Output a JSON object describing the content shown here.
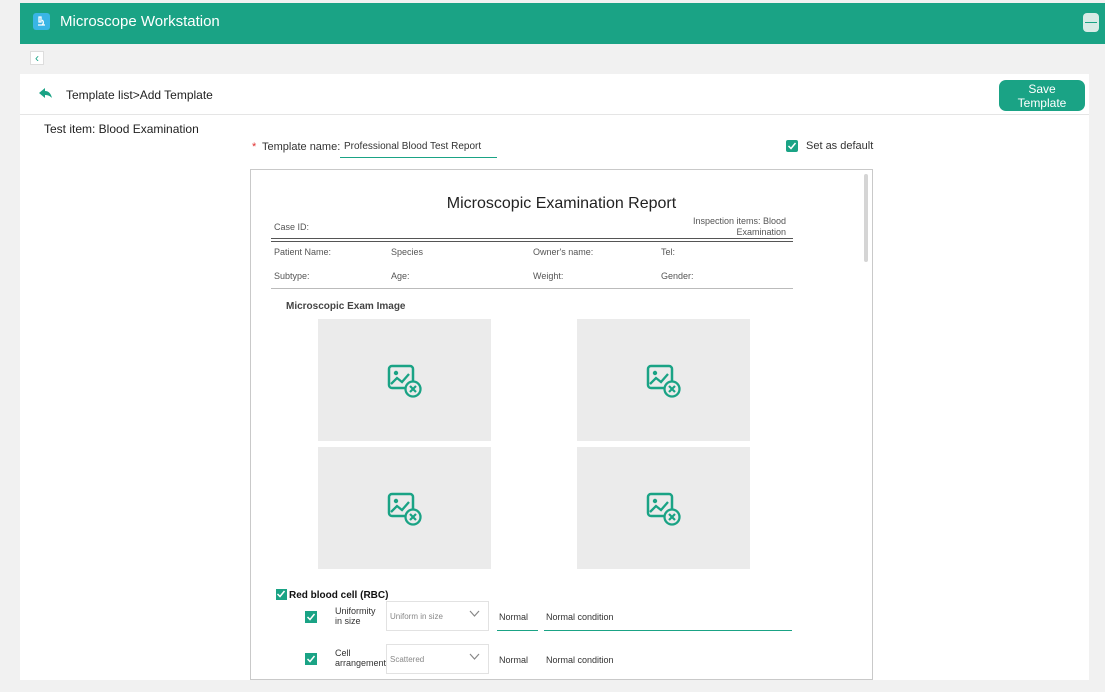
{
  "app": {
    "title": "Microscope Workstation"
  },
  "header": {
    "breadcrumb": "Template list>Add Template",
    "save_label": "Save Template"
  },
  "test_item": "Test item:  Blood Examination",
  "form": {
    "required_mark": "*",
    "template_name_label": "Template name:",
    "template_name_value": "Professional Blood Test Report",
    "set_default_label": "Set as default",
    "set_default_checked": true
  },
  "report": {
    "title": "Microscopic Examination Report",
    "case_id": "Case ID:",
    "inspection_items": "Inspection items: Blood Examination",
    "fields_row1": [
      "Patient Name:",
      "Species",
      "Owner's name:",
      "Tel:"
    ],
    "fields_row2": [
      "Subtype:",
      "Age:",
      "Weight:",
      "Gender:"
    ],
    "image_section_title": "Microscopic Exam Image",
    "image_placeholders": [
      "broken-image-icon",
      "broken-image-icon",
      "broken-image-icon",
      "broken-image-icon"
    ],
    "rbc_label": "Red blood cell (RBC)",
    "rows": [
      {
        "label": "Uniformity in size",
        "select": "Uniform in size",
        "normal": "Normal",
        "condition": "Normal condition"
      },
      {
        "label": "Cell arrangement",
        "select": "Scattered",
        "normal": "Normal",
        "condition": "Normal condition"
      }
    ]
  },
  "colors": {
    "accent": "#1aa385",
    "required": "#e03030",
    "image_bg": "#ebebeb"
  }
}
